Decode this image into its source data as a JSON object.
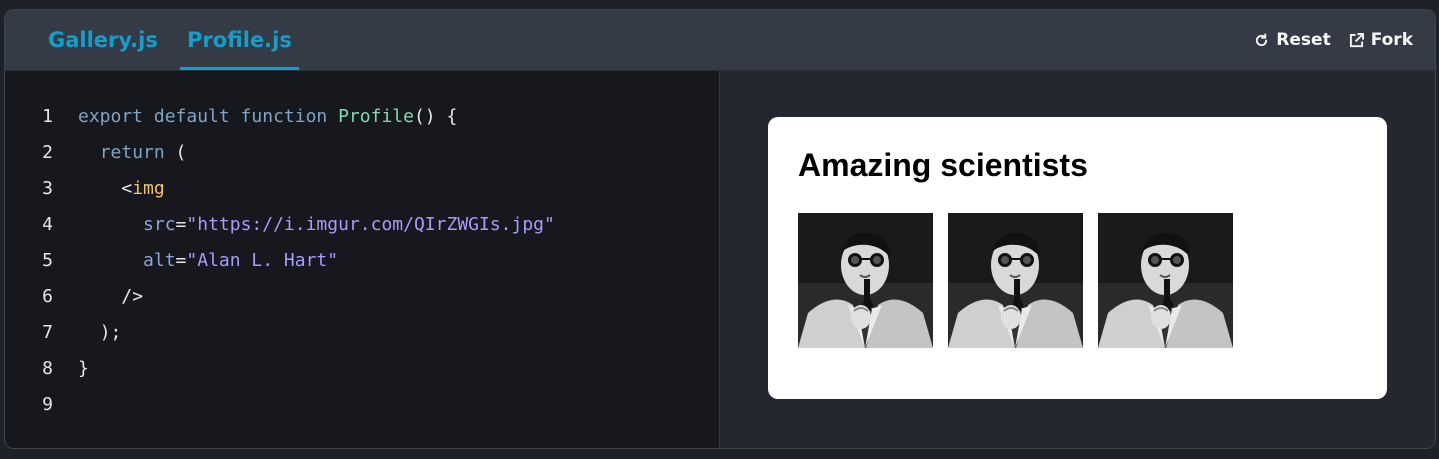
{
  "tabs": [
    {
      "label": "Gallery.js",
      "active": false
    },
    {
      "label": "Profile.js",
      "active": true
    }
  ],
  "actions": {
    "reset": "Reset",
    "fork": "Fork"
  },
  "code": {
    "line_numbers": [
      "1",
      "2",
      "3",
      "4",
      "5",
      "6",
      "7",
      "8",
      "9"
    ],
    "l1": {
      "kw": "export default function ",
      "fn": "Profile",
      "rest": "() {"
    },
    "l2": {
      "indent": "  ",
      "kw": "return",
      "rest": " ("
    },
    "l3": {
      "indent": "    ",
      "lt": "<",
      "tag": "img"
    },
    "l4": {
      "indent": "      ",
      "attr": "src",
      "eq": "=",
      "str": "\"https://i.imgur.com/QIrZWGIs.jpg\""
    },
    "l5": {
      "indent": "      ",
      "attr": "alt",
      "eq": "=",
      "str": "\"Alan L. Hart\""
    },
    "l6": {
      "indent": "    ",
      "rest": "/>"
    },
    "l7": {
      "indent": "  ",
      "rest": ");"
    },
    "l8": {
      "rest": "}"
    },
    "l9": {
      "rest": ""
    }
  },
  "preview": {
    "heading": "Amazing scientists",
    "images": [
      "Alan L. Hart",
      "Alan L. Hart",
      "Alan L. Hart"
    ]
  },
  "colors": {
    "accent": "#149eca",
    "editor_bg": "#16181d",
    "toolbar_bg": "#343a46"
  },
  "icons": {
    "reset": "refresh-icon",
    "fork": "external-link-icon"
  }
}
